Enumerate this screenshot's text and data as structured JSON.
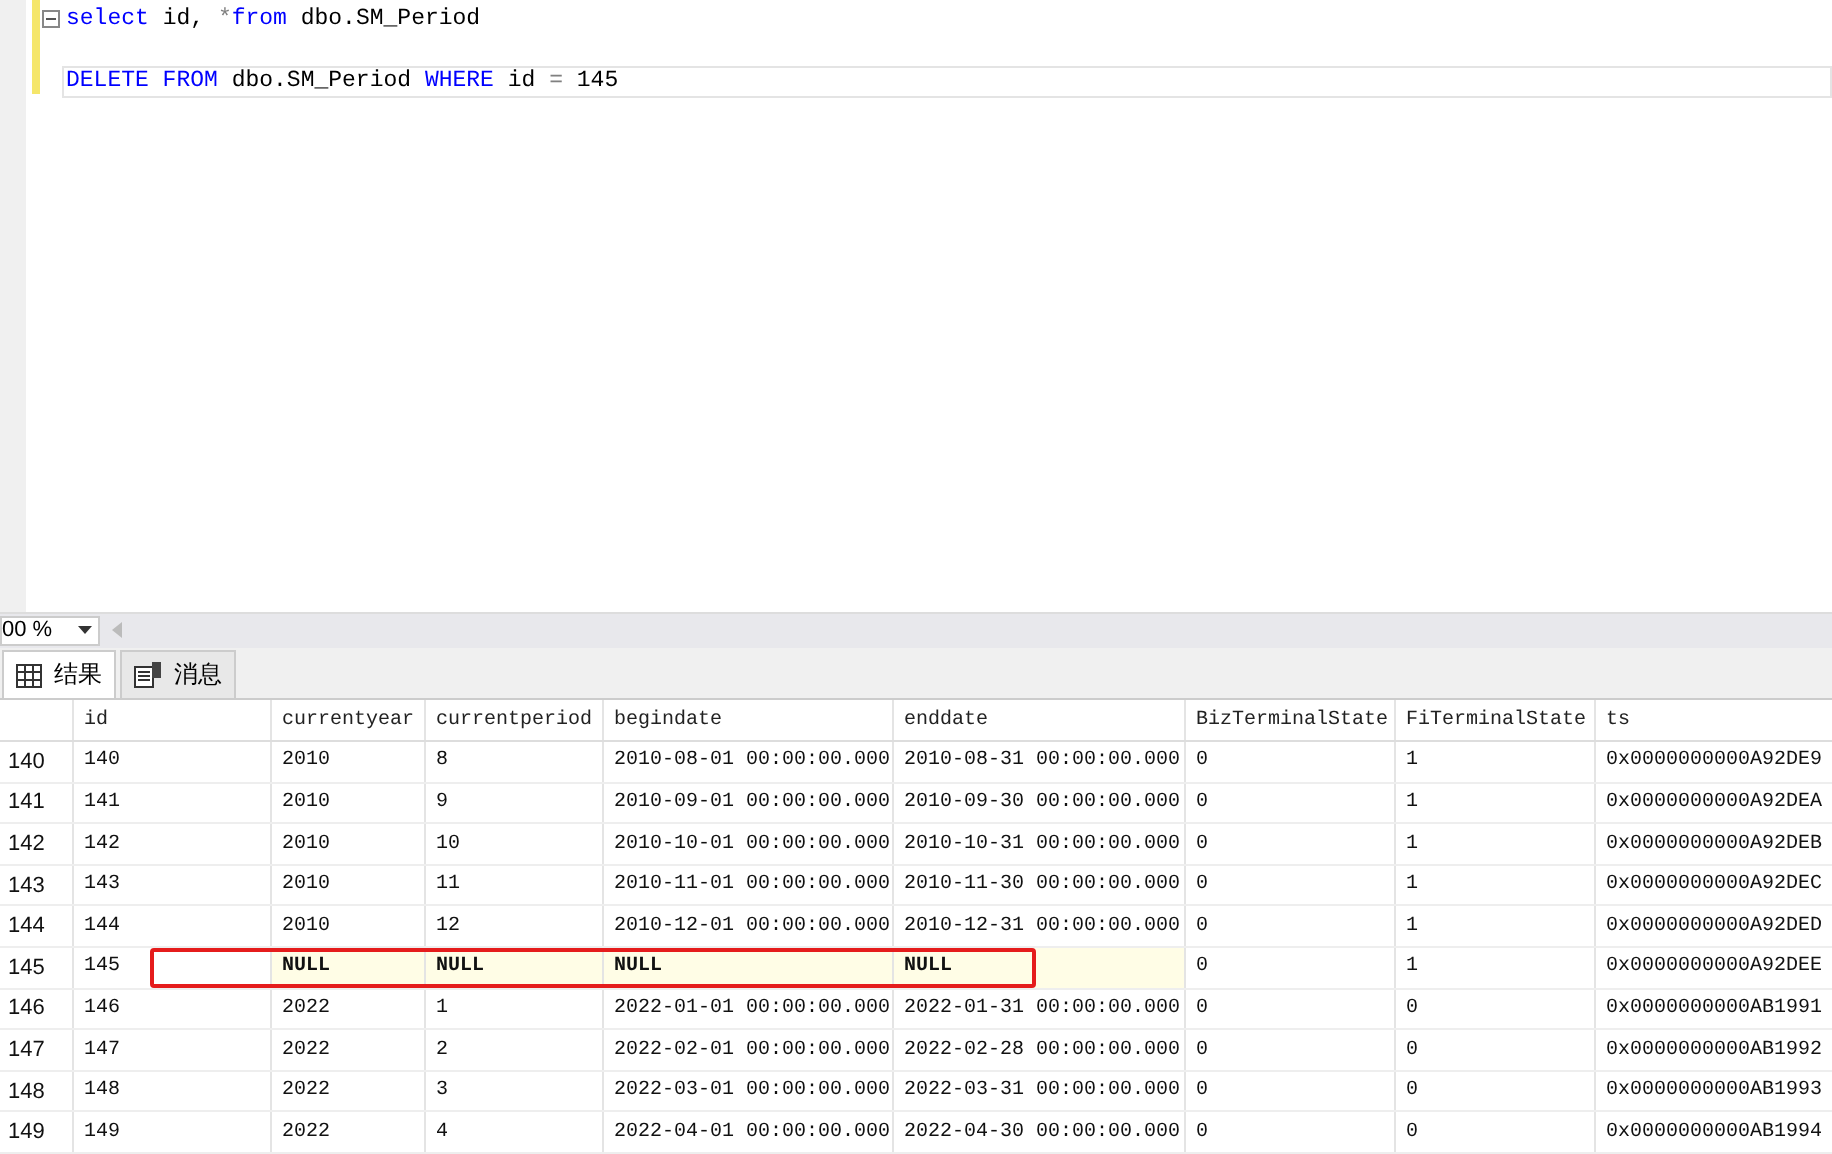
{
  "editor": {
    "lines": [
      {
        "collapsible": true,
        "current": false,
        "tokens": [
          {
            "text": "select",
            "kind": "keyword"
          },
          {
            "text": " id, ",
            "kind": "plain"
          },
          {
            "text": "*",
            "kind": "operator"
          },
          {
            "text": "from",
            "kind": "keyword"
          },
          {
            "text": " dbo.SM_Period",
            "kind": "plain"
          }
        ]
      },
      {
        "collapsible": false,
        "current": false
      },
      {
        "collapsible": false,
        "current": true,
        "tokens": [
          {
            "text": "DELETE FROM",
            "kind": "keyword"
          },
          {
            "text": " dbo.SM_Period ",
            "kind": "plain"
          },
          {
            "text": "WHERE",
            "kind": "keyword"
          },
          {
            "text": " id ",
            "kind": "plain"
          },
          {
            "text": "=",
            "kind": "operator"
          },
          {
            "text": " 145",
            "kind": "plain"
          }
        ]
      }
    ]
  },
  "zoom": {
    "value": "00 %"
  },
  "tabs": [
    {
      "label": "结果",
      "selected": true
    },
    {
      "label": "消息",
      "selected": false
    }
  ],
  "grid": {
    "columns": [
      "id",
      "currentyear",
      "currentperiod",
      "begindate",
      "enddate",
      "BizTerminalState",
      "FiTerminalState",
      "ts"
    ],
    "rows": [
      {
        "number": "140",
        "marked": false,
        "cells": [
          "140",
          "2010",
          "8",
          "2010-08-01 00:00:00.000",
          "2010-08-31 00:00:00.000",
          "0",
          "1",
          "0x0000000000A92DE9"
        ]
      },
      {
        "number": "141",
        "marked": false,
        "cells": [
          "141",
          "2010",
          "9",
          "2010-09-01 00:00:00.000",
          "2010-09-30 00:00:00.000",
          "0",
          "1",
          "0x0000000000A92DEA"
        ]
      },
      {
        "number": "142",
        "marked": false,
        "cells": [
          "142",
          "2010",
          "10",
          "2010-10-01 00:00:00.000",
          "2010-10-31 00:00:00.000",
          "0",
          "1",
          "0x0000000000A92DEB"
        ]
      },
      {
        "number": "143",
        "marked": false,
        "cells": [
          "143",
          "2010",
          "11",
          "2010-11-01 00:00:00.000",
          "2010-11-30 00:00:00.000",
          "0",
          "1",
          "0x0000000000A92DEC"
        ]
      },
      {
        "number": "144",
        "marked": false,
        "cells": [
          "144",
          "2010",
          "12",
          "2010-12-01 00:00:00.000",
          "2010-12-31 00:00:00.000",
          "0",
          "1",
          "0x0000000000A92DED"
        ]
      },
      {
        "number": "145",
        "marked": true,
        "cells": [
          "145",
          {
            "text": "NULL",
            "null": true
          },
          {
            "text": "NULL",
            "null": true
          },
          {
            "text": "NULL",
            "null": true
          },
          {
            "text": "NULL",
            "null": true
          },
          "0",
          "1",
          "0x0000000000A92DEE"
        ]
      },
      {
        "number": "146",
        "marked": false,
        "cells": [
          "146",
          "2022",
          "1",
          "2022-01-01 00:00:00.000",
          "2022-01-31 00:00:00.000",
          "0",
          "0",
          "0x0000000000AB1991"
        ]
      },
      {
        "number": "147",
        "marked": false,
        "cells": [
          "147",
          "2022",
          "2",
          "2022-02-01 00:00:00.000",
          "2022-02-28 00:00:00.000",
          "0",
          "0",
          "0x0000000000AB1992"
        ]
      },
      {
        "number": "148",
        "marked": false,
        "cells": [
          "148",
          "2022",
          "3",
          "2022-03-01 00:00:00.000",
          "2022-03-31 00:00:00.000",
          "0",
          "0",
          "0x0000000000AB1993"
        ]
      },
      {
        "number": "149",
        "marked": false,
        "cells": [
          "149",
          "2022",
          "4",
          "2022-04-01 00:00:00.000",
          "2022-04-30 00:00:00.000",
          "0",
          "0",
          "0x0000000000AB1994"
        ]
      }
    ]
  }
}
